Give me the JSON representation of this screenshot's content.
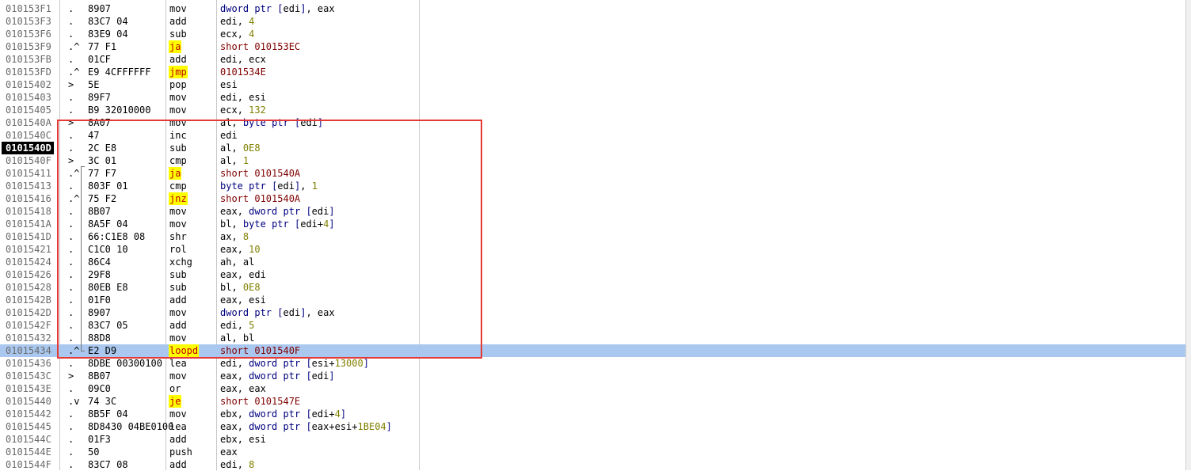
{
  "disassembly": {
    "rows": [
      {
        "addr": "010153F1",
        "mark": ".",
        "hex": "8907",
        "mn": "mov",
        "ops": "dword ptr [edi], eax"
      },
      {
        "addr": "010153F3",
        "mark": ".",
        "hex": "83C7 04",
        "mn": "add",
        "ops": "edi, 4"
      },
      {
        "addr": "010153F6",
        "mark": ".",
        "hex": "83E9 04",
        "mn": "sub",
        "ops": "ecx, 4"
      },
      {
        "addr": "010153F9",
        "mark": ".^",
        "hex": "77 F1",
        "mn": "ja",
        "ops": "short 010153EC",
        "jump": true
      },
      {
        "addr": "010153FB",
        "mark": ".",
        "hex": "01CF",
        "mn": "add",
        "ops": "edi, ecx"
      },
      {
        "addr": "010153FD",
        "mark": ".^",
        "hex": "E9 4CFFFFFF",
        "mn": "jmp",
        "ops": "0101534E",
        "jump": true
      },
      {
        "addr": "01015402",
        "mark": ">",
        "hex": "5E",
        "mn": "pop",
        "ops": "esi"
      },
      {
        "addr": "01015403",
        "mark": ".",
        "hex": "89F7",
        "mn": "mov",
        "ops": "edi, esi"
      },
      {
        "addr": "01015405",
        "mark": ".",
        "hex": "B9 32010000",
        "mn": "mov",
        "ops": "ecx, 132"
      },
      {
        "addr": "0101540A",
        "mark": ">",
        "hex": "8A07",
        "mn": "mov",
        "ops": "al, byte ptr [edi]"
      },
      {
        "addr": "0101540C",
        "mark": ".",
        "hex": "47",
        "mn": "inc",
        "ops": "edi"
      },
      {
        "addr": "0101540D",
        "mark": ".",
        "hex": "2C E8",
        "mn": "sub",
        "ops": "al, 0E8",
        "selected": true
      },
      {
        "addr": "0101540F",
        "mark": ">",
        "hex": "3C 01",
        "mn": "cmp",
        "ops": "al, 1"
      },
      {
        "addr": "01015411",
        "mark": ".^",
        "hex": "77 F7",
        "mn": "ja",
        "ops": "short 0101540A",
        "jump": true
      },
      {
        "addr": "01015413",
        "mark": ".",
        "hex": "803F 01",
        "mn": "cmp",
        "ops": "byte ptr [edi], 1"
      },
      {
        "addr": "01015416",
        "mark": ".^",
        "hex": "75 F2",
        "mn": "jnz",
        "ops": "short 0101540A",
        "jump": true
      },
      {
        "addr": "01015418",
        "mark": ".",
        "hex": "8B07",
        "mn": "mov",
        "ops": "eax, dword ptr [edi]"
      },
      {
        "addr": "0101541A",
        "mark": ".",
        "hex": "8A5F 04",
        "mn": "mov",
        "ops": "bl, byte ptr [edi+4]"
      },
      {
        "addr": "0101541D",
        "mark": ".",
        "hex": "66:C1E8 08",
        "mn": "shr",
        "ops": "ax, 8"
      },
      {
        "addr": "01015421",
        "mark": ".",
        "hex": "C1C0 10",
        "mn": "rol",
        "ops": "eax, 10"
      },
      {
        "addr": "01015424",
        "mark": ".",
        "hex": "86C4",
        "mn": "xchg",
        "ops": "ah, al"
      },
      {
        "addr": "01015426",
        "mark": ".",
        "hex": "29F8",
        "mn": "sub",
        "ops": "eax, edi"
      },
      {
        "addr": "01015428",
        "mark": ".",
        "hex": "80EB E8",
        "mn": "sub",
        "ops": "bl, 0E8"
      },
      {
        "addr": "0101542B",
        "mark": ".",
        "hex": "01F0",
        "mn": "add",
        "ops": "eax, esi"
      },
      {
        "addr": "0101542D",
        "mark": ".",
        "hex": "8907",
        "mn": "mov",
        "ops": "dword ptr [edi], eax"
      },
      {
        "addr": "0101542F",
        "mark": ".",
        "hex": "83C7 05",
        "mn": "add",
        "ops": "edi, 5"
      },
      {
        "addr": "01015432",
        "mark": ".",
        "hex": "88D8",
        "mn": "mov",
        "ops": "al, bl"
      },
      {
        "addr": "01015434",
        "mark": ".^",
        "hex": "E2 D9",
        "mn": "loopd",
        "ops": "short 0101540F",
        "jump": true,
        "current": true
      },
      {
        "addr": "01015436",
        "mark": ".",
        "hex": "8DBE 00300100",
        "mn": "lea",
        "ops": "edi, dword ptr [esi+13000]"
      },
      {
        "addr": "0101543C",
        "mark": ">",
        "hex": "8B07",
        "mn": "mov",
        "ops": "eax, dword ptr [edi]"
      },
      {
        "addr": "0101543E",
        "mark": ".",
        "hex": "09C0",
        "mn": "or",
        "ops": "eax, eax"
      },
      {
        "addr": "01015440",
        "mark": ".v",
        "hex": "74 3C",
        "mn": "je",
        "ops": "short 0101547E",
        "jump": true
      },
      {
        "addr": "01015442",
        "mark": ".",
        "hex": "8B5F 04",
        "mn": "mov",
        "ops": "ebx, dword ptr [edi+4]"
      },
      {
        "addr": "01015445",
        "mark": ".",
        "hex": "8D8430 04BE0100",
        "mn": "lea",
        "ops": "eax, dword ptr [eax+esi+1BE04]"
      },
      {
        "addr": "0101544C",
        "mark": ".",
        "hex": "01F3",
        "mn": "add",
        "ops": "ebx, esi"
      },
      {
        "addr": "0101544E",
        "mark": ".",
        "hex": "50",
        "mn": "push",
        "ops": "eax"
      },
      {
        "addr": "0101544F",
        "mark": ".",
        "hex": "83C7 08",
        "mn": "add",
        "ops": "edi, 8"
      }
    ]
  },
  "colors": {
    "current_row": "#aac8ef",
    "jump_highlight": "#ffff00",
    "jump_text": "#c00000",
    "annotation_box": "#e53935"
  }
}
